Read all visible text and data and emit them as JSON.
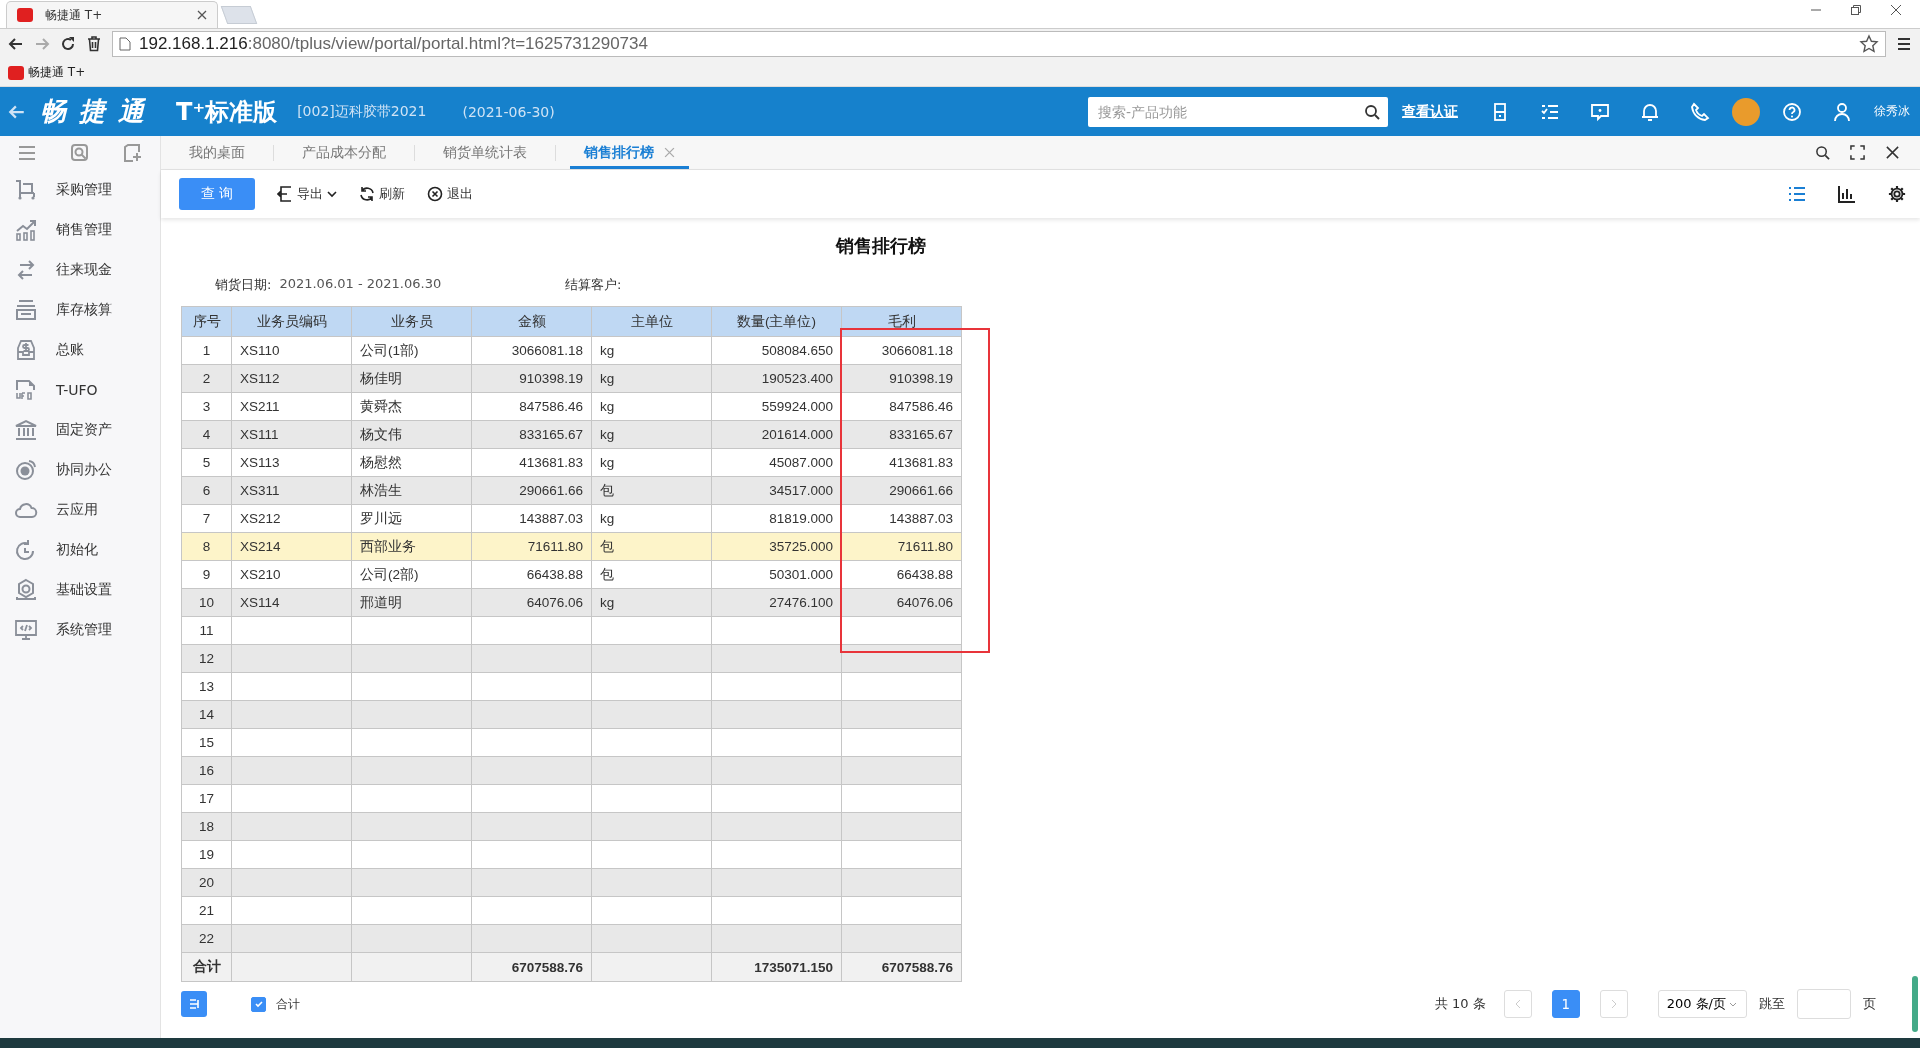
{
  "browser": {
    "tab_title": "畅捷通 T+",
    "url_host": "192.168.1.216",
    "url_rest": ":8080/tplus/view/portal/portal.html?t=1625731290734",
    "bookmark": "畅捷通 T+"
  },
  "header": {
    "brand": "畅 捷 通",
    "edition": "T⁺标准版",
    "company": "[002]迈科胶带2021",
    "date": "(2021-06-30)",
    "search_placeholder": "搜索-产品功能",
    "verify_link": "查看认证",
    "user": "徐秀冰"
  },
  "sidebar": {
    "items": [
      {
        "label": "采购管理",
        "kind": "cart"
      },
      {
        "label": "销售管理",
        "kind": "chart"
      },
      {
        "label": "往来现金",
        "kind": "swap"
      },
      {
        "label": "库存核算",
        "kind": "stock"
      },
      {
        "label": "总账",
        "kind": "money"
      },
      {
        "label": "T-UFO",
        "kind": "file"
      },
      {
        "label": "固定资产",
        "kind": "bank"
      },
      {
        "label": "协同办公",
        "kind": "target"
      },
      {
        "label": "云应用",
        "kind": "cloud"
      },
      {
        "label": "初始化",
        "kind": "reset"
      },
      {
        "label": "基础设置",
        "kind": "gear"
      },
      {
        "label": "系统管理",
        "kind": "monitor"
      }
    ]
  },
  "tabs": [
    {
      "label": "我的桌面",
      "selected": false
    },
    {
      "label": "产品成本分配",
      "selected": false
    },
    {
      "label": "销货单统计表",
      "selected": false
    },
    {
      "label": "销售排行榜",
      "selected": true
    }
  ],
  "toolbar": {
    "query": "查 询",
    "export": "导出",
    "refresh": "刷新",
    "exit": "退出"
  },
  "report": {
    "title": "销售排行榜",
    "filters": [
      {
        "label": "销货日期:",
        "value": "2021.06.01 - 2021.06.30"
      },
      {
        "label": "结算客户:"
      }
    ]
  },
  "table": {
    "columns": [
      "序号",
      "业务员编码",
      "业务员",
      "金额",
      "主单位",
      "数量(主单位)",
      "毛利"
    ],
    "rows": [
      {
        "cells": [
          "1",
          "XS110",
          "公司(1部)",
          "3066081.18",
          "kg",
          "508084.650",
          "3066081.18"
        ],
        "selected": false
      },
      {
        "cells": [
          "2",
          "XS112",
          "杨佳明",
          "910398.19",
          "kg",
          "190523.400",
          "910398.19"
        ],
        "selected": false
      },
      {
        "cells": [
          "3",
          "XS211",
          "黄舜杰",
          "847586.46",
          "kg",
          "559924.000",
          "847586.46"
        ],
        "selected": false
      },
      {
        "cells": [
          "4",
          "XS111",
          "杨文伟",
          "833165.67",
          "kg",
          "201614.000",
          "833165.67"
        ],
        "selected": false
      },
      {
        "cells": [
          "5",
          "XS113",
          "杨慰然",
          "413681.83",
          "kg",
          "45087.000",
          "413681.83"
        ],
        "selected": false
      },
      {
        "cells": [
          "6",
          "XS311",
          "林浩生",
          "290661.66",
          "包",
          "34517.000",
          "290661.66"
        ],
        "selected": false
      },
      {
        "cells": [
          "7",
          "XS212",
          "罗川远",
          "143887.03",
          "kg",
          "81819.000",
          "143887.03"
        ],
        "selected": false
      },
      {
        "cells": [
          "8",
          "XS214",
          "西部业务",
          "71611.80",
          "包",
          "35725.000",
          "71611.80"
        ],
        "selected": true
      },
      {
        "cells": [
          "9",
          "XS210",
          "公司(2部)",
          "66438.88",
          "包",
          "50301.000",
          "66438.88"
        ],
        "selected": false
      },
      {
        "cells": [
          "10",
          "XS114",
          "邢道明",
          "64076.06",
          "kg",
          "27476.100",
          "64076.06"
        ],
        "selected": false
      },
      {
        "cells": [
          "11"
        ],
        "selected": false
      },
      {
        "cells": [
          "12"
        ],
        "selected": false
      },
      {
        "cells": [
          "13"
        ],
        "selected": false
      },
      {
        "cells": [
          "14"
        ],
        "selected": false
      },
      {
        "cells": [
          "15"
        ],
        "selected": false
      },
      {
        "cells": [
          "16"
        ],
        "selected": false
      },
      {
        "cells": [
          "17"
        ],
        "selected": false
      },
      {
        "cells": [
          "18"
        ],
        "selected": false
      },
      {
        "cells": [
          "19"
        ],
        "selected": false
      },
      {
        "cells": [
          "20"
        ],
        "selected": false
      },
      {
        "cells": [
          "21"
        ],
        "selected": false
      },
      {
        "cells": [
          "22"
        ],
        "selected": false
      }
    ],
    "total": {
      "label": "合计",
      "amount": "6707588.76",
      "quantity": "1735071.150",
      "profit": "6707588.76"
    }
  },
  "footer": {
    "total_toggle": {
      "label": "合计",
      "checked": true
    },
    "count": "共 10 条",
    "pages": [
      {
        "label": "1",
        "selected": true
      }
    ],
    "page_size": "200 条/页",
    "jump_label": "跳至",
    "page_unit": "页"
  }
}
